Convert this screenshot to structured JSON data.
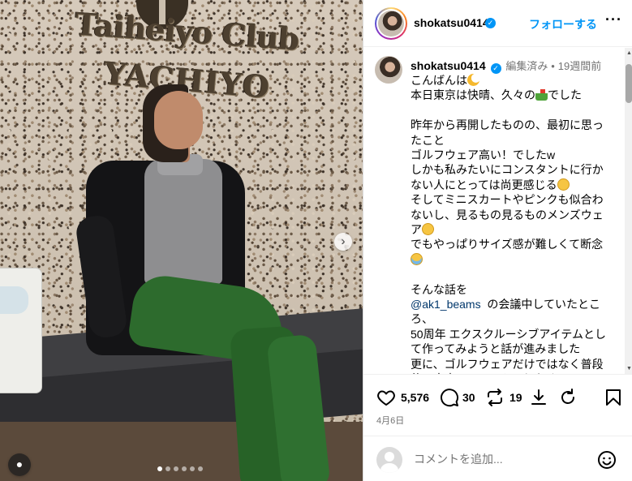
{
  "media": {
    "sign_line1": "Taiheiyo Club",
    "sign_line2": "YACHIYO",
    "next_icon": "›",
    "user_tag_icon": "person-icon",
    "carousel_dots": 6,
    "active_dot": 0
  },
  "header": {
    "username": "shokatsu0414",
    "verified_mark": "✓",
    "follow_label": "フォローする",
    "more_label": "···"
  },
  "caption": {
    "username": "shokatsu0414",
    "edited": "編集済み",
    "separator": "•",
    "time_ago": "19週間前",
    "lines": [
      "こんばんは",
      "本日東京は快晴、久々の",
      "でした",
      "",
      "昨年から再開したものの、最初に思ったこと",
      "ゴルフウェア高い！でしたw",
      "しかも私みたいにコンスタントに行かない人にとっては尚更感じる",
      "そしてミニスカートやピンクも似合わないし、見るもの見るものメンズウェア",
      "でもやっぱりサイズ感が難しくて断念",
      "",
      "そんな話を",
      "@ak1_beams",
      "の会議中していたところ、",
      "50周年 エクスクルーシブアイテムとして作ってみようと話が進みました",
      "更に、ゴルフウェアだけではなく普段使い出来るアイテムにしたくて、"
    ]
  },
  "actions": {
    "like_count": "5,576",
    "comment_count": "30",
    "repost_count": "19"
  },
  "date": "4月6日",
  "comment": {
    "placeholder": "コメントを追加..."
  },
  "colors": {
    "accent": "#0095f6",
    "mention": "#00376b",
    "muted": "#737373"
  }
}
